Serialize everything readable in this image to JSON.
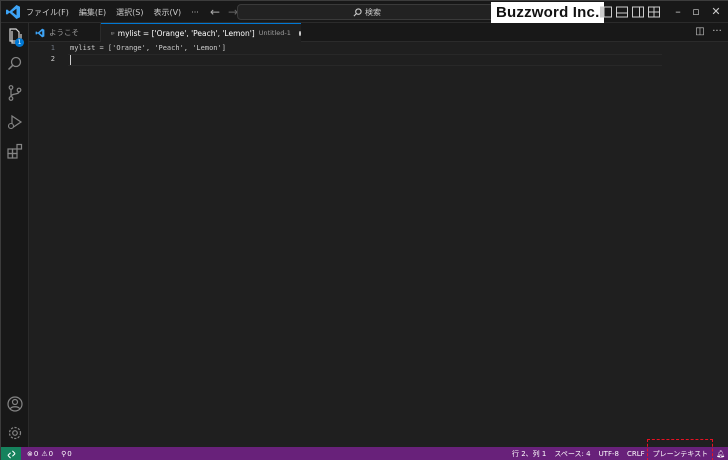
{
  "menu": [
    "ファイル(F)",
    "編集(E)",
    "選択(S)",
    "表示(V)",
    "···"
  ],
  "search": {
    "placeholder": "検索"
  },
  "brand": "Buzzword Inc.",
  "tabs": {
    "welcome": "ようこそ",
    "active_label": "mylist = ['Orange', 'Peach', 'Lemon']",
    "active_desc": "Untitled-1"
  },
  "editor": {
    "lines": [
      {
        "number": "1",
        "text": "mylist = ['Orange', 'Peach', 'Lemon']"
      },
      {
        "number": "2",
        "text": ""
      }
    ]
  },
  "activity": {
    "explorer_badge": "1"
  },
  "status": {
    "errors": "0",
    "warnings": "0",
    "ports": "0",
    "position": "行 2、列 1",
    "spaces": "スペース: 4",
    "encoding": "UTF-8",
    "eol": "CRLF",
    "language": "プレーンテキスト"
  },
  "colors": {
    "accent": "#0078d4",
    "statusbar": "#68217a",
    "remote": "#16825d",
    "highlight": "#e81123"
  }
}
